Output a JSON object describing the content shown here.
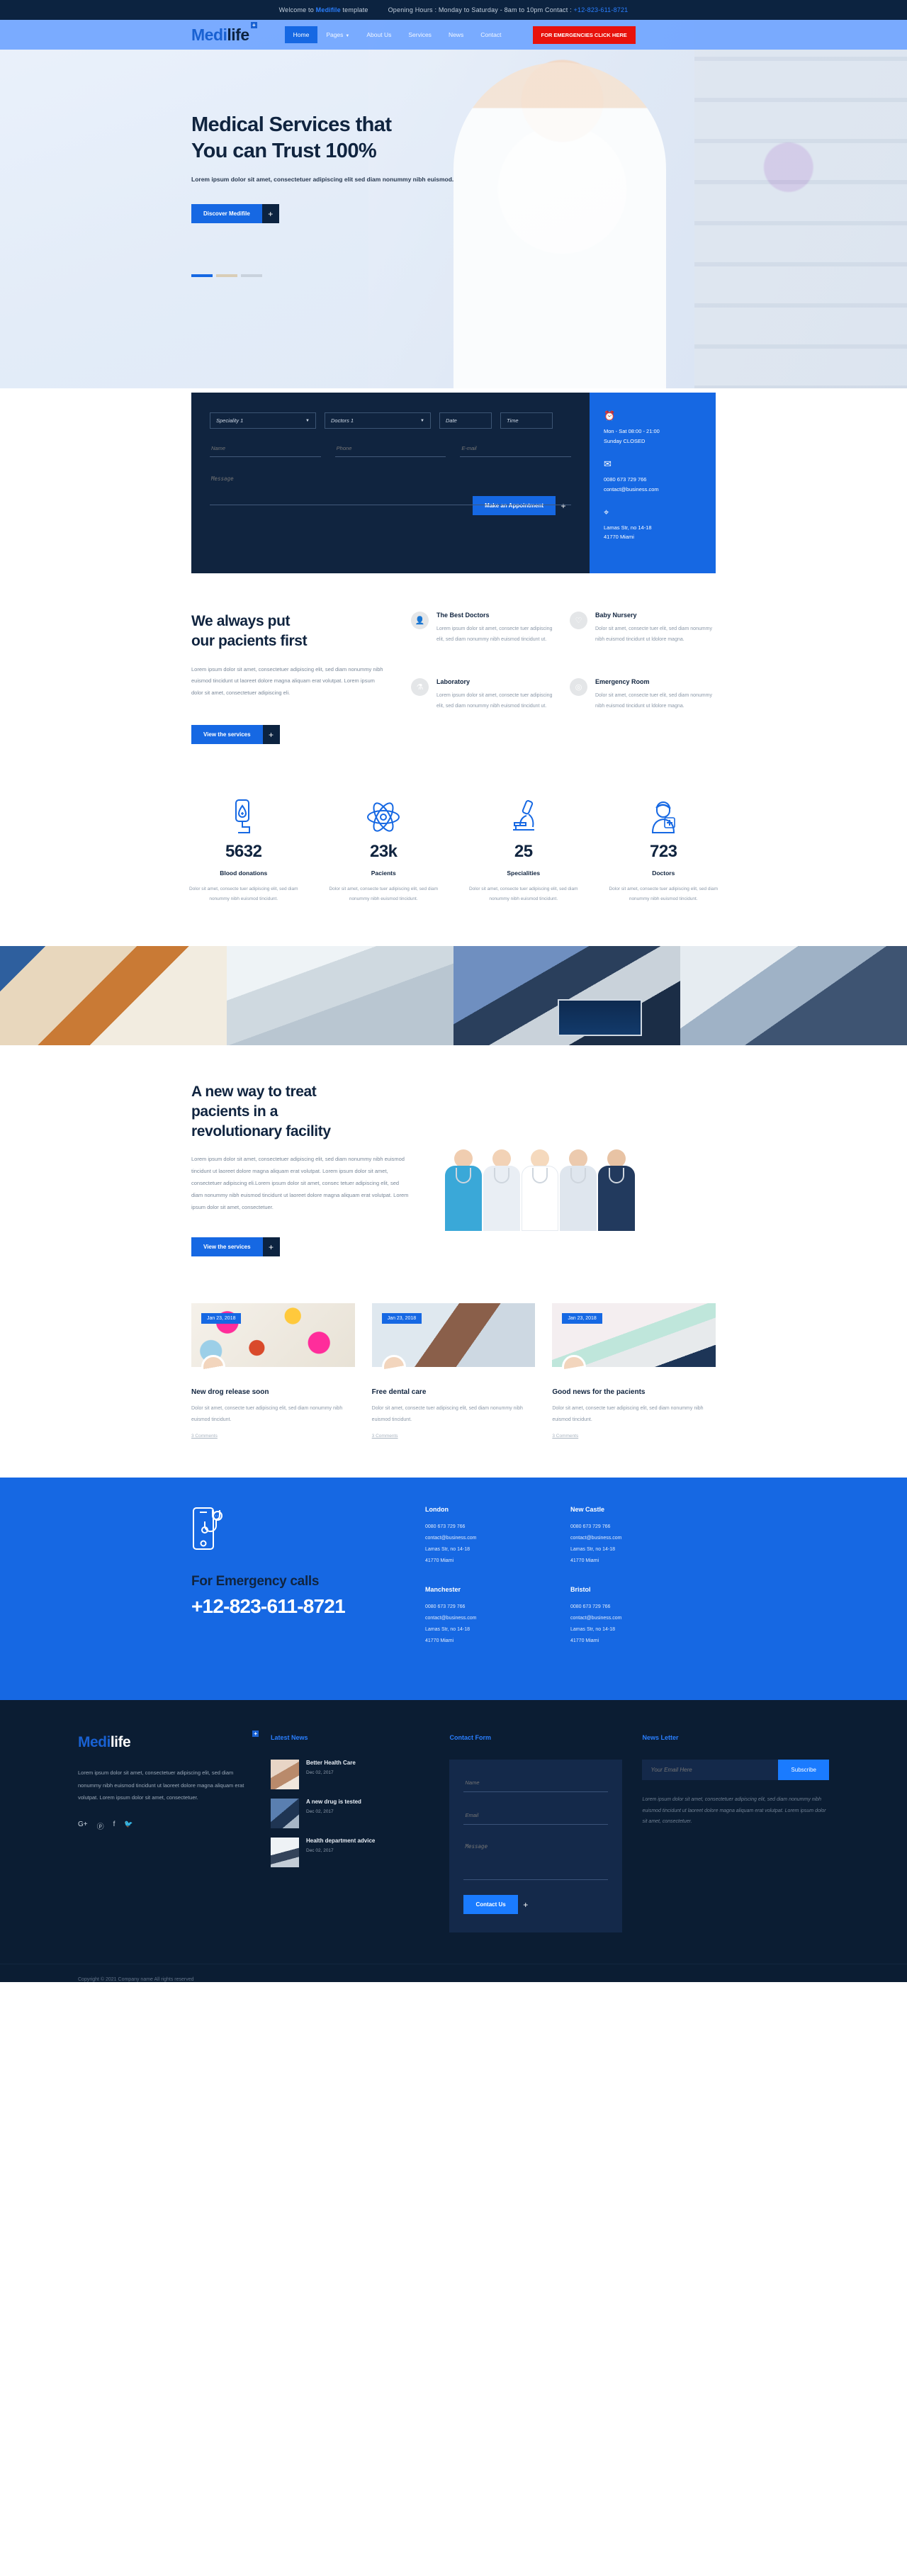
{
  "topbar": {
    "welcome_prefix": "Welcome to ",
    "welcome_brand": "Medifile",
    "welcome_suffix": " template",
    "hours": "Opening Hours : Monday to Saturday - 8am to 10pm Contact : ",
    "phone": "+12-823-611-8721"
  },
  "brand": {
    "part1": "Medi",
    "part2": "life",
    "plus": "+"
  },
  "nav": {
    "items": [
      {
        "label": "Home",
        "active": true,
        "caret": ""
      },
      {
        "label": "Pages",
        "active": false,
        "caret": "▼"
      },
      {
        "label": "About Us",
        "active": false,
        "caret": ""
      },
      {
        "label": "Services",
        "active": false,
        "caret": ""
      },
      {
        "label": "News",
        "active": false,
        "caret": ""
      },
      {
        "label": "Contact",
        "active": false,
        "caret": ""
      }
    ],
    "emergency_button": "FOR EMERGENCIES CLICK HERE"
  },
  "hero": {
    "title_line1": "Medical Services that",
    "title_line2": "You can Trust 100%",
    "subtitle": "Lorem ipsum dolor sit amet, consectetuer adipiscing elit sed diam nonummy nibh euismod.",
    "cta": "Discover Medifile",
    "cta_plus": "+"
  },
  "appointment": {
    "speciality": "Speciality 1",
    "doctors": "Doctors 1",
    "date_placeholder": "Date",
    "time_placeholder": "Time",
    "name_placeholder": "Name",
    "phone_placeholder": "Phone",
    "email_placeholder": "E-mail",
    "message_placeholder": "Message",
    "submit": "Make an Appointment",
    "submit_plus": "+",
    "info": [
      {
        "icon": "clock-icon",
        "glyph": "⏰",
        "lines": [
          "Mon - Sat 08:00 - 21:00",
          "Sunday CLOSED"
        ]
      },
      {
        "icon": "envelope-icon",
        "glyph": "✉",
        "lines": [
          "0080 673 729 766",
          "contact@business.com"
        ]
      },
      {
        "icon": "location-pin-icon",
        "glyph": "⌖",
        "lines": [
          "Lamas Str, no 14-18",
          "41770 Miami"
        ]
      }
    ]
  },
  "patients_first": {
    "title_line1": "We always put",
    "title_line2": "our pacients first",
    "body": "Lorem ipsum dolor sit amet, consectetuer adipiscing elit, sed diam nonummy nibh euismod tincidunt ut laoreet dolore magna aliquam erat volutpat. Lorem ipsum dolor sit amet, consectetuer adipiscing eli.",
    "cta": "View the services",
    "cta_plus": "+",
    "services": [
      {
        "icon": "doctor-icon",
        "glyph": "👤",
        "title": "The Best Doctors",
        "desc": "Lorem ipsum dolor sit amet, consecte tuer adipiscing elit, sed diam nonummy nibh euismod tincidunt ut."
      },
      {
        "icon": "baby-icon",
        "glyph": "♡",
        "title": "Baby Nursery",
        "desc": "Dolor sit amet, consecte tuer elit, sed diam nonummy nibh euismod tincidunt ut ldolore magna."
      },
      {
        "icon": "flask-icon",
        "glyph": "⚗",
        "title": "Laboratory",
        "desc": "Lorem ipsum dolor sit amet, consecte tuer adipiscing elit, sed diam nonummy nibh euismod tincidunt ut."
      },
      {
        "icon": "emergency-icon",
        "glyph": "◎",
        "title": "Emergency Room",
        "desc": "Dolor sit amet, consecte tuer elit, sed diam nonummy nibh euismod tincidunt ut ldolore magna."
      }
    ]
  },
  "stats": [
    {
      "icon": "blood-bag-icon",
      "number": "5632",
      "label": "Blood donations",
      "desc": "Dolor sit amet, consecte tuer adipiscing elit, sed diam nonummy nibh euismod tincidunt."
    },
    {
      "icon": "atom-icon",
      "number": "23k",
      "label": "Pacients",
      "desc": "Dolor sit amet, consecte tuer adipiscing elit, sed diam nonummy nibh euismod tincidunt."
    },
    {
      "icon": "microscope-icon",
      "number": "25",
      "label": "Specialities",
      "desc": "Dolor sit amet, consecte tuer adipiscing elit, sed diam nonummy nibh euismod tincidunt."
    },
    {
      "icon": "doctor-badge-icon",
      "number": "723",
      "label": "Doctors",
      "desc": "Dolor sit amet, consecte tuer adipiscing elit, sed diam nonummy nibh euismod tincidunt."
    }
  ],
  "gallery": [
    {
      "name": "hospital-meal-tray-photo"
    },
    {
      "name": "surgeon-with-mask-photo"
    },
    {
      "name": "operating-room-monitor-photo"
    },
    {
      "name": "surgery-team-photo"
    }
  ],
  "new_way": {
    "title_line1": "A new way to treat",
    "title_line2": "pacients in a",
    "title_line3": "revolutionary facility",
    "body": "Lorem ipsum dolor sit amet, consectetuer adipiscing elit, sed diam nonummy nibh euismod tincidunt ut laoreet dolore magna aliquam erat volutpat. Lorem ipsum dolor sit amet, consectetuer adipiscing eli.Lorem ipsum dolor sit amet, consec tetuer adipiscing elit, sed diam nonummy nibh euismod tincidunt ut laoreet dolore magna aliquam erat volutpat. Lorem ipsum dolor sit amet, consectetuer.",
    "cta": "View the services",
    "cta_plus": "+"
  },
  "news": [
    {
      "date": "Jan 23, 2018",
      "title": "New drog release soon",
      "desc": "Dolor sit amet, consecte tuer adipiscing elit, sed diam nonummy nibh euismod tincidunt.",
      "comments": "3 Comments"
    },
    {
      "date": "Jan 23, 2018",
      "title": "Free dental care",
      "desc": "Dolor sit amet, consecte tuer adipiscing elit, sed diam nonummy nibh euismod tincidunt.",
      "comments": "3 Comments"
    },
    {
      "date": "Jan 23, 2018",
      "title": "Good news for the pacients",
      "desc": "Dolor sit amet, consecte tuer adipiscing elit, sed diam nonummy nibh euismod tincidunt.",
      "comments": "3 Comments"
    }
  ],
  "emergency": {
    "heading": "For Emergency calls",
    "number": "+12-823-611-8721",
    "cities": [
      {
        "name": "London",
        "lines": [
          "0080 673 729 766",
          "contact@business.com",
          "Lamas Str, no 14-18",
          "41770 Miami"
        ]
      },
      {
        "name": "New Castle",
        "lines": [
          "0080 673 729 766",
          "contact@business.com",
          "Lamas Str, no 14-18",
          "41770 Miami"
        ]
      },
      {
        "name": "Manchester",
        "lines": [
          "0080 673 729 766",
          "contact@business.com",
          "Lamas Str, no 14-18",
          "41770 Miami"
        ]
      },
      {
        "name": "Bristol",
        "lines": [
          "0080 673 729 766",
          "contact@business.com",
          "Lamas Str, no 14-18",
          "41770 Miami"
        ]
      }
    ]
  },
  "footer": {
    "about": "Lorem ipsum dolor sit amet, consectetuer adipiscing elit, sed diam nonummy nibh euismod tincidunt ut laoreet dolore magna aliquam erat volutpat. Lorem ipsum dolor sit amet, consectetuer.",
    "social": [
      {
        "name": "google-plus-icon",
        "glyph": "G+"
      },
      {
        "name": "pinterest-icon",
        "glyph": "ⓟ"
      },
      {
        "name": "facebook-icon",
        "glyph": "f"
      },
      {
        "name": "twitter-icon",
        "glyph": "🐦"
      }
    ],
    "latest_news_heading": "Latest News",
    "latest_news": [
      {
        "title": "Better Health Care",
        "date": "Dec 02, 2017"
      },
      {
        "title": "A new drug is tested",
        "date": "Dec 02, 2017"
      },
      {
        "title": "Health department advice",
        "date": "Dec 02, 2017"
      }
    ],
    "contact_form_heading": "Contact Form",
    "contact_form": {
      "name_placeholder": "Name",
      "email_placeholder": "Email",
      "message_placeholder": "Message",
      "submit": "Contact Us",
      "submit_plus": "+"
    },
    "newsletter_heading": "News Letter",
    "newsletter": {
      "email_placeholder": "Your Email Here",
      "subscribe": "Subscribe",
      "desc": "Lorem ipsum dolor sit amet, consectetuer adipiscing elit, sed diam nonummy nibh euismod tincidunt ut laoreet dolore magna aliquam erat volutpat. Lorem ipsum dolor sit amet, consectetuer."
    },
    "copyright": "Copyright © 2021 Company name All rights reserved"
  },
  "colors": {
    "brand_blue": "#1668e3",
    "bright_blue": "#1a7bff",
    "dark_navy": "#0b1d33",
    "heading_navy": "#10243f",
    "emergency_red": "#e8120c"
  }
}
